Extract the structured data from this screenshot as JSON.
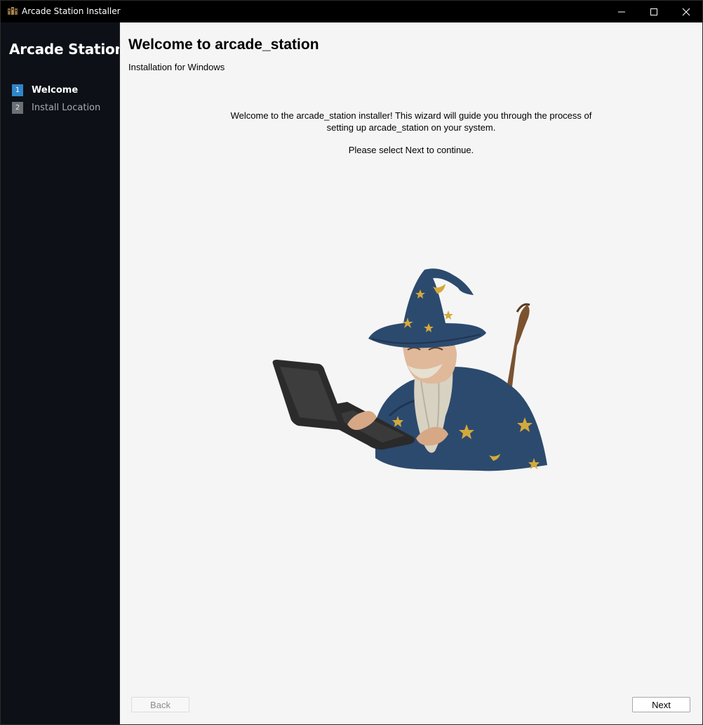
{
  "window": {
    "title": "Arcade Station Installer"
  },
  "sidebar": {
    "brand": "Arcade Station",
    "steps": [
      {
        "number": "1",
        "label": "Welcome",
        "state": "active"
      },
      {
        "number": "2",
        "label": "Install Location",
        "state": "inactive"
      }
    ]
  },
  "main": {
    "title": "Welcome to arcade_station",
    "subtitle": "Installation for Windows",
    "intro": "Welcome to the arcade_station installer! This wizard will guide you through the process of setting up arcade_station on your system.",
    "continue_text": "Please select Next to continue.",
    "illustration": "wizard-with-laptop"
  },
  "buttons": {
    "back": "Back",
    "next": "Next"
  },
  "colors": {
    "sidebar_bg": "#0d1117",
    "accent": "#2f86c9",
    "content_bg": "#f5f5f5"
  }
}
